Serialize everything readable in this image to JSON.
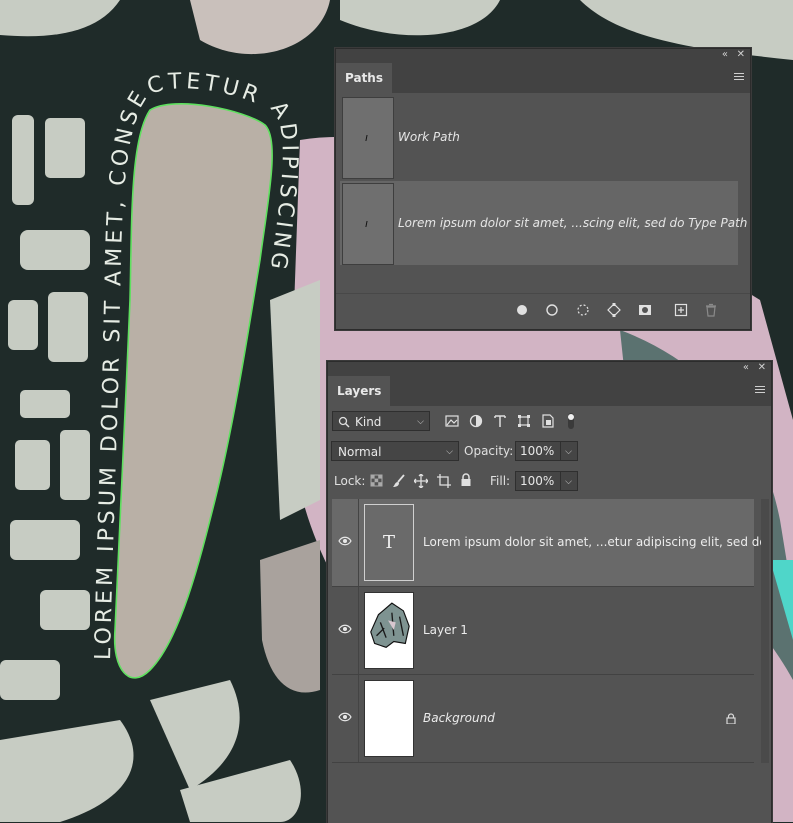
{
  "paths_panel": {
    "tab": "Paths",
    "collapse_glyph": "«",
    "close_glyph": "✕",
    "paths": [
      {
        "name": "Work Path",
        "thumb_glyph": "ı",
        "selected": false
      },
      {
        "name": "Lorem ipsum dolor sit amet, ...scing elit, sed do Type Path",
        "thumb_glyph": "ı",
        "selected": true
      }
    ],
    "footer_icons": [
      "fill-path-icon",
      "stroke-path-icon",
      "load-selection-icon",
      "make-work-path-icon",
      "add-mask-icon",
      "new-path-icon",
      "delete-path-icon"
    ]
  },
  "layers_panel": {
    "tab": "Layers",
    "collapse_glyph": "«",
    "close_glyph": "✕",
    "filter_kind": "Kind",
    "filter_icons": [
      "pixel-filter-icon",
      "adjustment-filter-icon",
      "type-filter-icon",
      "shape-filter-icon",
      "smart-object-filter-icon",
      "filter-toggle-icon"
    ],
    "blend_mode": "Normal",
    "opacity_label": "Opacity:",
    "opacity_value": "100%",
    "lock_label": "Lock:",
    "fill_label": "Fill:",
    "fill_value": "100%",
    "layers": [
      {
        "name": "Lorem ipsum dolor sit amet, ...etur adipiscing elit, sed do",
        "kind": "type",
        "thumb_glyph": "T",
        "visible": true,
        "selected": true,
        "italic": false,
        "locked": false
      },
      {
        "name": "Layer 1",
        "kind": "pixel",
        "visible": true,
        "selected": false,
        "italic": false,
        "locked": false
      },
      {
        "name": "Background",
        "kind": "background",
        "visible": true,
        "selected": false,
        "italic": true,
        "locked": true
      }
    ]
  },
  "canvas": {
    "path_text": "LOREM IPSUM DOLOR SIT AMET, CONSECTETUR ADIPISCING",
    "colors": {
      "dark": "#1f2b29",
      "light_shape": "#c7ccc3",
      "path_fill": "#b9b0a6",
      "pink": "#d9b9c9",
      "path_stroke": "#5fe05f"
    }
  }
}
